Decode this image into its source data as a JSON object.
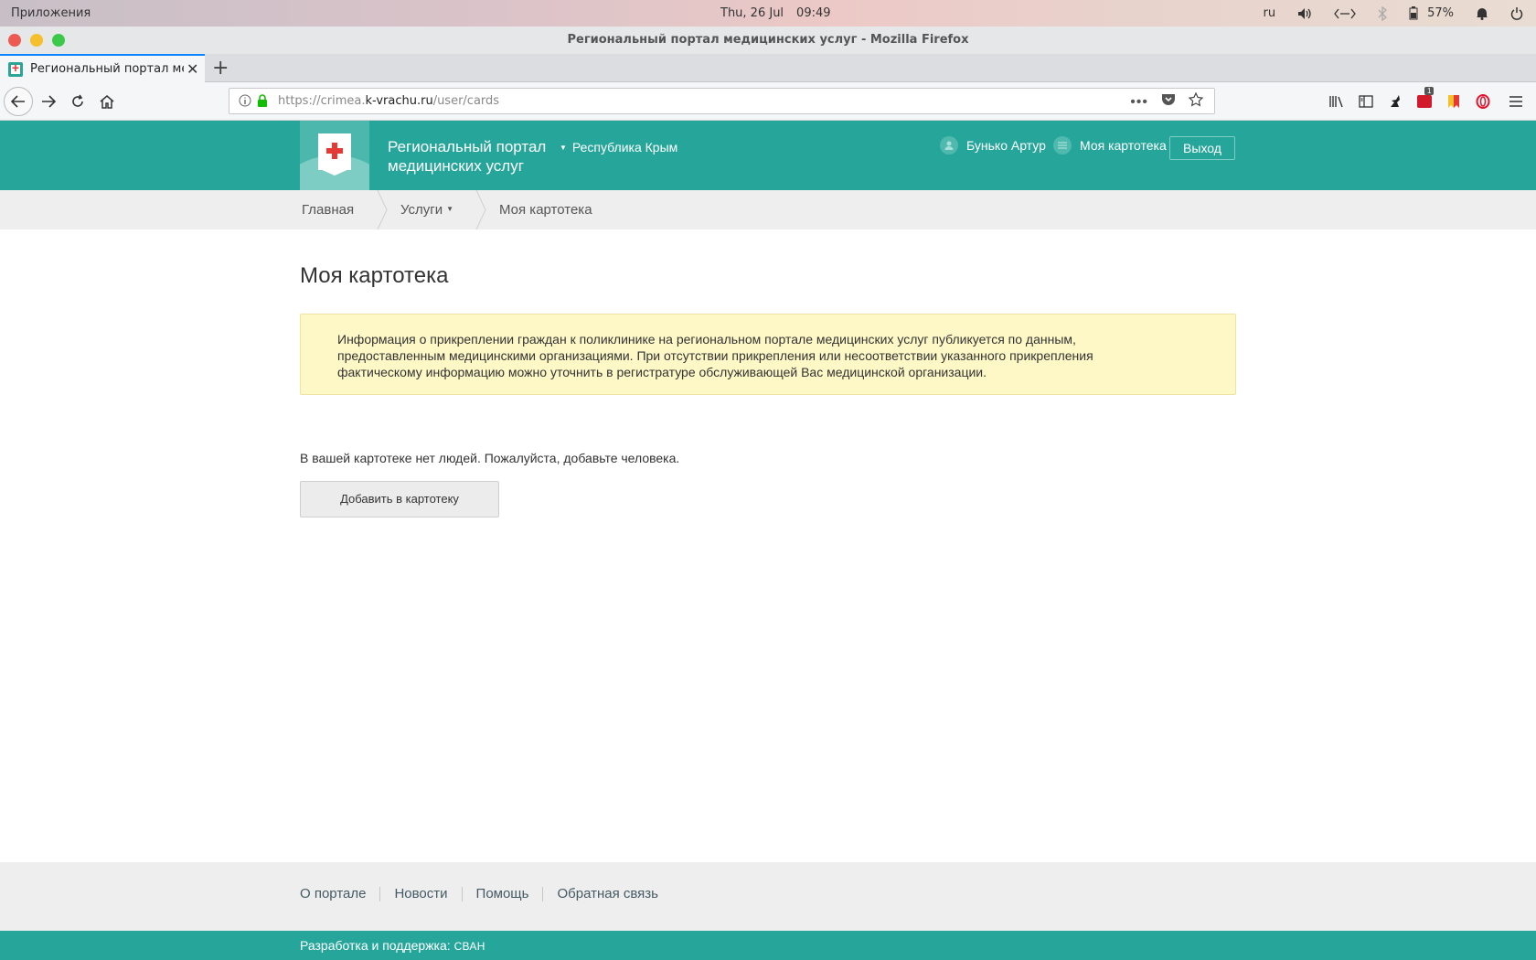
{
  "os": {
    "apps_label": "Приложения",
    "date": "Thu, 26 Jul",
    "time": "09:49",
    "lang": "ru",
    "battery": "57%"
  },
  "browser": {
    "window_title": "Региональный портал медицинских услуг - Mozilla Firefox",
    "tab_title": "Региональный портал меди",
    "url_prefix": "https://crimea.",
    "url_domain": "k-vrachu.ru",
    "url_path": "/user/cards",
    "badge_count": "1",
    "colors": {
      "tab_accent": "#0a84ff",
      "lock": "#12bc00"
    }
  },
  "site": {
    "name_line1": "Региональный портал",
    "name_line2": "медицинских услуг",
    "region": "Республика Крым",
    "user_name": "Бунько Артур",
    "cards_link": "Моя картотека",
    "logout": "Выход",
    "colors": {
      "primary": "#26a69a",
      "notice_bg": "#fdf8c6"
    }
  },
  "breadcrumbs": {
    "home": "Главная",
    "services": "Услуги",
    "current": "Моя картотека"
  },
  "main": {
    "title": "Моя картотека",
    "notice": "Информация о прикреплении граждан к поликлинике на региональном портале медицинских услуг публикуется по данным, предоставленным медицинскими организациями. При отсутствии прикрепления или несоответствии указанного прикрепления фактическому информацию можно уточнить в регистратуре обслуживающей Вас медицинской организации.",
    "empty_message": "В вашей картотеке нет людей. Пожалуйста, добавьте человека.",
    "add_button": "Добавить в картотеку"
  },
  "footer": {
    "links": [
      "О портале",
      "Новости",
      "Помощь",
      "Обратная связь"
    ],
    "dev_label": "Разработка и поддержка:",
    "dev_brand": "СВАН"
  }
}
